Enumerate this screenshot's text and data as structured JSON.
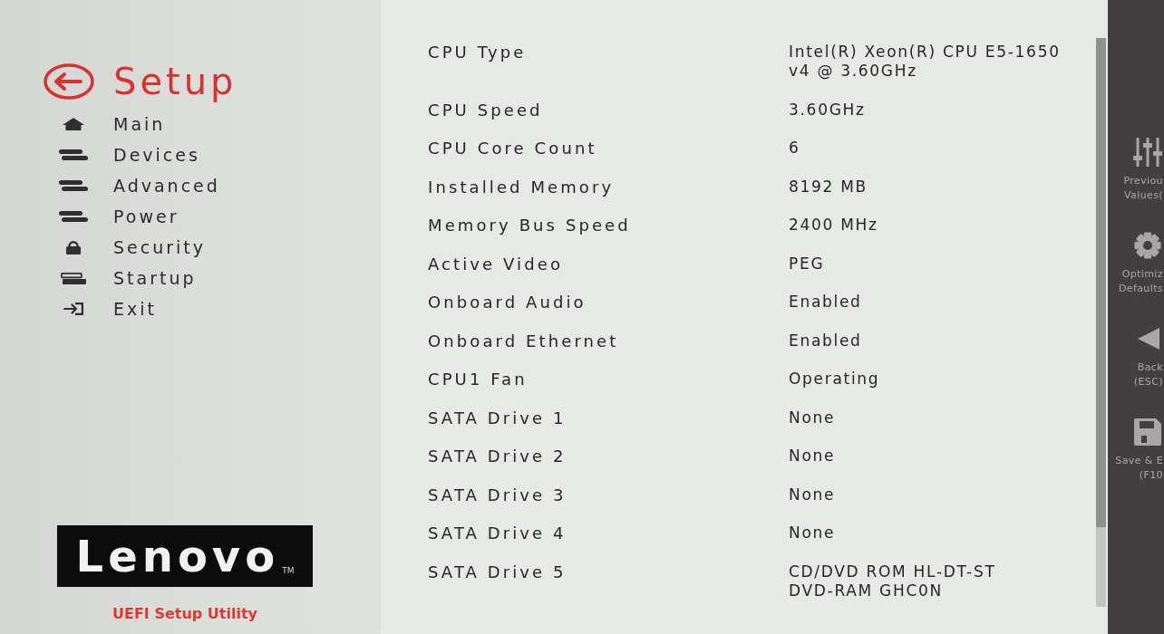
{
  "sidebar": {
    "title": "Setup",
    "menu": [
      {
        "label": "Main"
      },
      {
        "label": "Devices"
      },
      {
        "label": "Advanced"
      },
      {
        "label": "Power"
      },
      {
        "label": "Security"
      },
      {
        "label": "Startup"
      },
      {
        "label": "Exit"
      }
    ],
    "logo": {
      "wordmark": "Lenovo",
      "trademark": "TM"
    },
    "product": "UEFI Setup Utility"
  },
  "info": [
    {
      "label": "CPU Type",
      "value": "Intel(R) Xeon(R) CPU E5-1650 v4 @ 3.60GHz"
    },
    {
      "label": "CPU Speed",
      "value": "3.60GHz"
    },
    {
      "label": "CPU Core Count",
      "value": "6"
    },
    {
      "label": "Installed Memory",
      "value": "8192 MB"
    },
    {
      "label": "Memory Bus Speed",
      "value": "2400 MHz"
    },
    {
      "label": "Active Video",
      "value": "PEG"
    },
    {
      "label": "Onboard Audio",
      "value": "Enabled"
    },
    {
      "label": "Onboard Ethernet",
      "value": "Enabled"
    },
    {
      "label": "CPU1 Fan",
      "value": "Operating"
    },
    {
      "label": "SATA Drive 1",
      "value": "None"
    },
    {
      "label": "SATA Drive 2",
      "value": "None"
    },
    {
      "label": "SATA Drive 3",
      "value": "None"
    },
    {
      "label": "SATA Drive 4",
      "value": "None"
    },
    {
      "label": "SATA Drive 5",
      "value": "CD/DVD ROM HL-DT-ST DVD-RAM GHC0N"
    }
  ],
  "actions": [
    {
      "lines": [
        "Previou",
        "Values("
      ]
    },
    {
      "lines": [
        "Optimiz",
        "Defaults"
      ]
    },
    {
      "lines": [
        "Back",
        "(ESC)"
      ]
    },
    {
      "lines": [
        "Save & E",
        "(F10"
      ]
    }
  ]
}
